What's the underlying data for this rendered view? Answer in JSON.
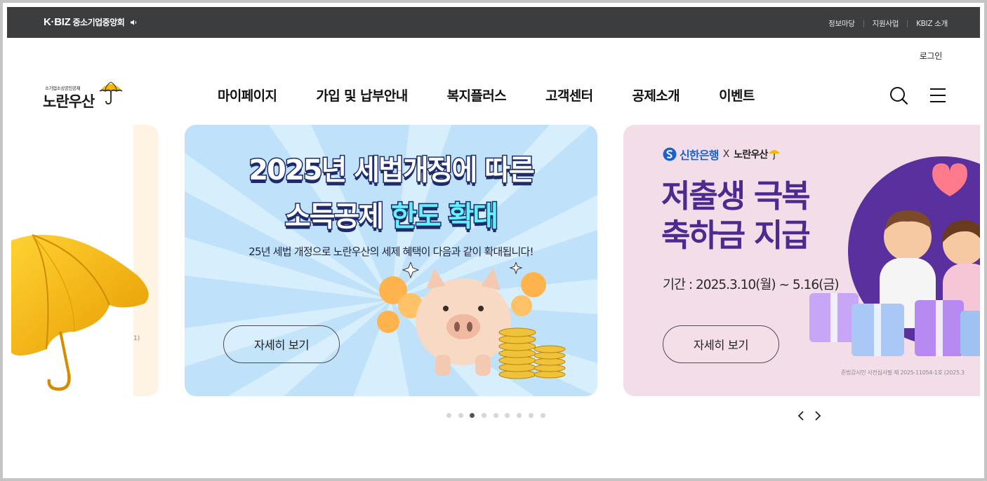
{
  "topbar": {
    "brand": "K·BIZ",
    "org_name": "중소기업중앙회",
    "links": [
      "정보마당",
      "지원사업",
      "KBIZ 소개"
    ]
  },
  "header": {
    "login": "로그인",
    "logo_sub": "소기업소상공인공제",
    "logo_main": "노란우산",
    "nav": [
      "마이페이지",
      "가입 및 납부안내",
      "복지플러스",
      "고객센터",
      "공제소개",
      "이벤트"
    ]
  },
  "slides": {
    "left_fragment": "1)",
    "main": {
      "headline_line1": "2025년 세법개정에 따른",
      "headline_line2_a": "소득공제",
      "headline_line2_b": "한도 확대",
      "description": "25년 세법 개정으로 노란우산의 세제 혜택이 다음과 같이 확대됩니다!",
      "button": "자세히 보기"
    },
    "right": {
      "partner_bank": "신한은행",
      "partner_x": "X",
      "partner_sub": "소기업소상공인공제",
      "partner_brand": "노란우산",
      "title_line1": "저출생 극복",
      "title_line2": "축하금 지급",
      "period": "기간 : 2025.3.10(월) ~ 5.16(금)",
      "button": "자세히 보기",
      "notice": "준법감시인 사전심사필 제 2025-11054-1호 (2025.3"
    }
  },
  "pagination": {
    "count": 9,
    "active_index": 2
  },
  "colors": {
    "topbar": "#3b3d3f",
    "umbrella_yellow": "#f5b800",
    "main_slide_bg": "#bfe2fa",
    "right_slide_bg": "#f3dde8",
    "right_title": "#4d2a90",
    "shinhan_blue": "#1c63c9"
  },
  "icons": [
    "speaker-icon",
    "umbrella-logo-icon",
    "search-icon",
    "hamburger-menu-icon",
    "prev-arrow-icon",
    "next-arrow-icon",
    "shinhan-logo-icon"
  ]
}
